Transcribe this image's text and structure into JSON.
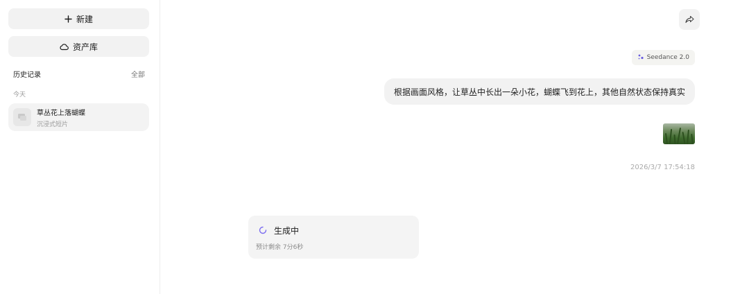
{
  "sidebar": {
    "new_label": "新建",
    "assets_label": "资产库",
    "history_label": "历史记录",
    "all_label": "全部",
    "group_today": "今天",
    "items": [
      {
        "title": "草丛花上落蝴蝶",
        "subtitle": "沉浸式短片"
      }
    ]
  },
  "chat": {
    "model_badge": "Seedance 2.0",
    "user_message": "根据画面风格，让草丛中长出一朵小花，蝴蝶飞到花上，其他自然状态保持真实",
    "timestamp": "2026/3/7 17:54:18",
    "generation": {
      "status": "生成中",
      "eta_label": "预计剩余",
      "eta_value": "7分6秒"
    }
  },
  "colors": {
    "spinner_accent": "#7b6cf0",
    "bubble_bg": "#f2f2f2",
    "sidebar_item_bg": "#f3f3f3"
  },
  "icons": {
    "new": "plus-icon",
    "assets": "cloud-icon",
    "history_item": "chat-thumbnail-icon",
    "share": "share-icon",
    "model": "sparkle-icon",
    "status": "loading-spinner-icon"
  }
}
